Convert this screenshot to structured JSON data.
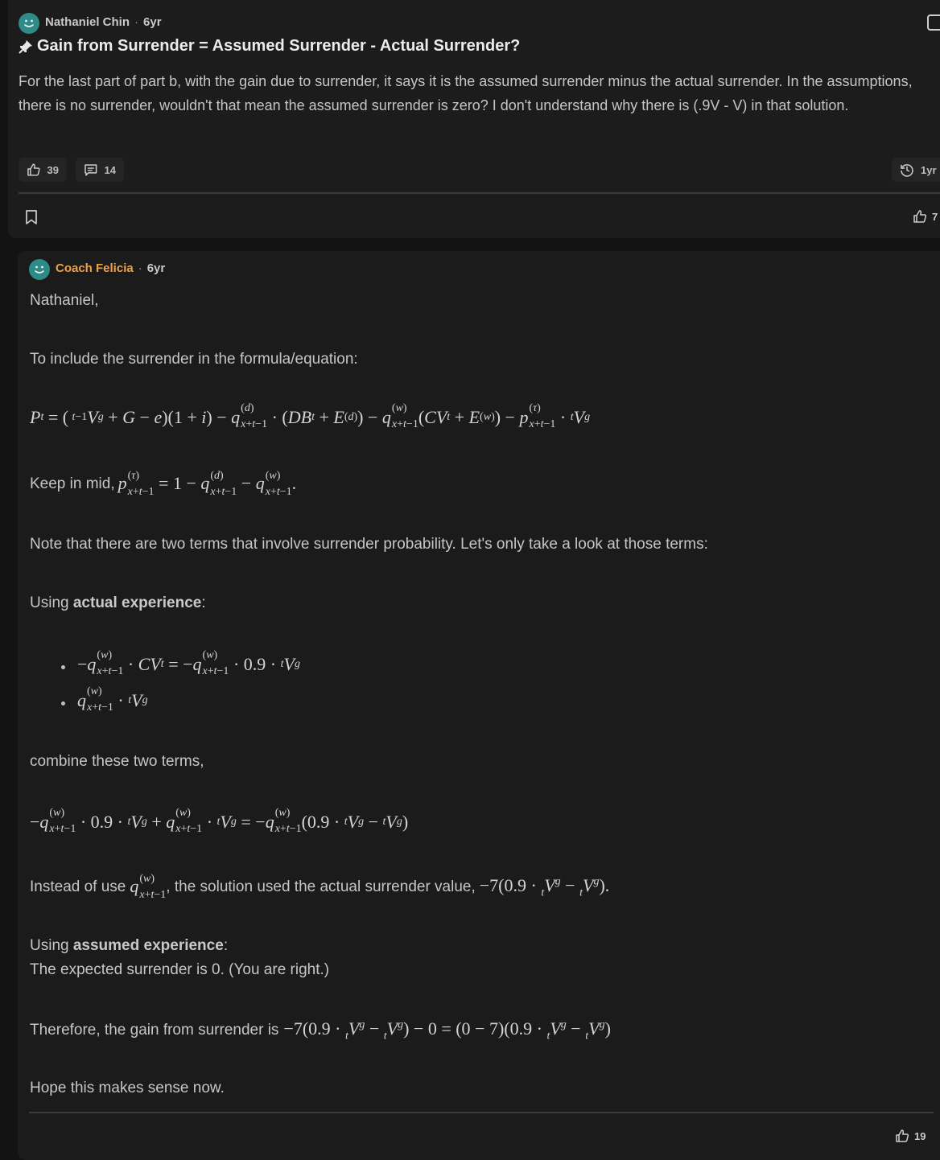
{
  "post": {
    "author": "Nathaniel Chin",
    "separator": "·",
    "age": "6yr",
    "title": "Gain from Surrender = Assumed Surrender - Actual Surrender?",
    "body": "For the last part of part b, with the gain due to surrender, it says it is the assumed surrender minus the actual surrender. In the assumptions, there is no surrender, wouldn't that mean the assumed surrender is zero? I don't understand why there is (.9V - V) in that solution.",
    "likes": "39",
    "comments": "14",
    "history_age": "1yr",
    "footer_likes": "7"
  },
  "reply": {
    "author": "Coach Felicia",
    "separator": "·",
    "age": "6yr",
    "greeting": "Nathaniel,",
    "intro": "To include the surrender in the formula/equation:",
    "keep_in_mind": "Keep in mid,",
    "note": "Note that there are two terms that involve surrender probability. Let's only take a look at those terms:",
    "using_actual_prefix": "Using ",
    "using_actual_bold": "actual experience",
    "colon": ":",
    "combine": "combine these two terms,",
    "instead_prefix": "Instead of use",
    "instead_suffix": ", the solution used the actual surrender value,",
    "using_assumed_prefix": "Using ",
    "using_assumed_bold": "assumed experience",
    "expected_zero": "The expected surrender is 0. (You are right.)",
    "therefore": "Therefore, the gain from surrender is",
    "closing": "Hope this makes sense now.",
    "likes": "19"
  },
  "icons": {
    "avatar": "smiley-avatar-icon",
    "pin": "pin-icon",
    "like": "thumbs-up-icon",
    "comment": "comment-icon",
    "history": "history-icon",
    "bookmark": "bookmark-icon",
    "flag": "flag-icon"
  },
  "colors": {
    "background": "#131313",
    "card": "#1c1c1c",
    "avatar": "#2e8b87",
    "coach_name": "#f0a045"
  }
}
